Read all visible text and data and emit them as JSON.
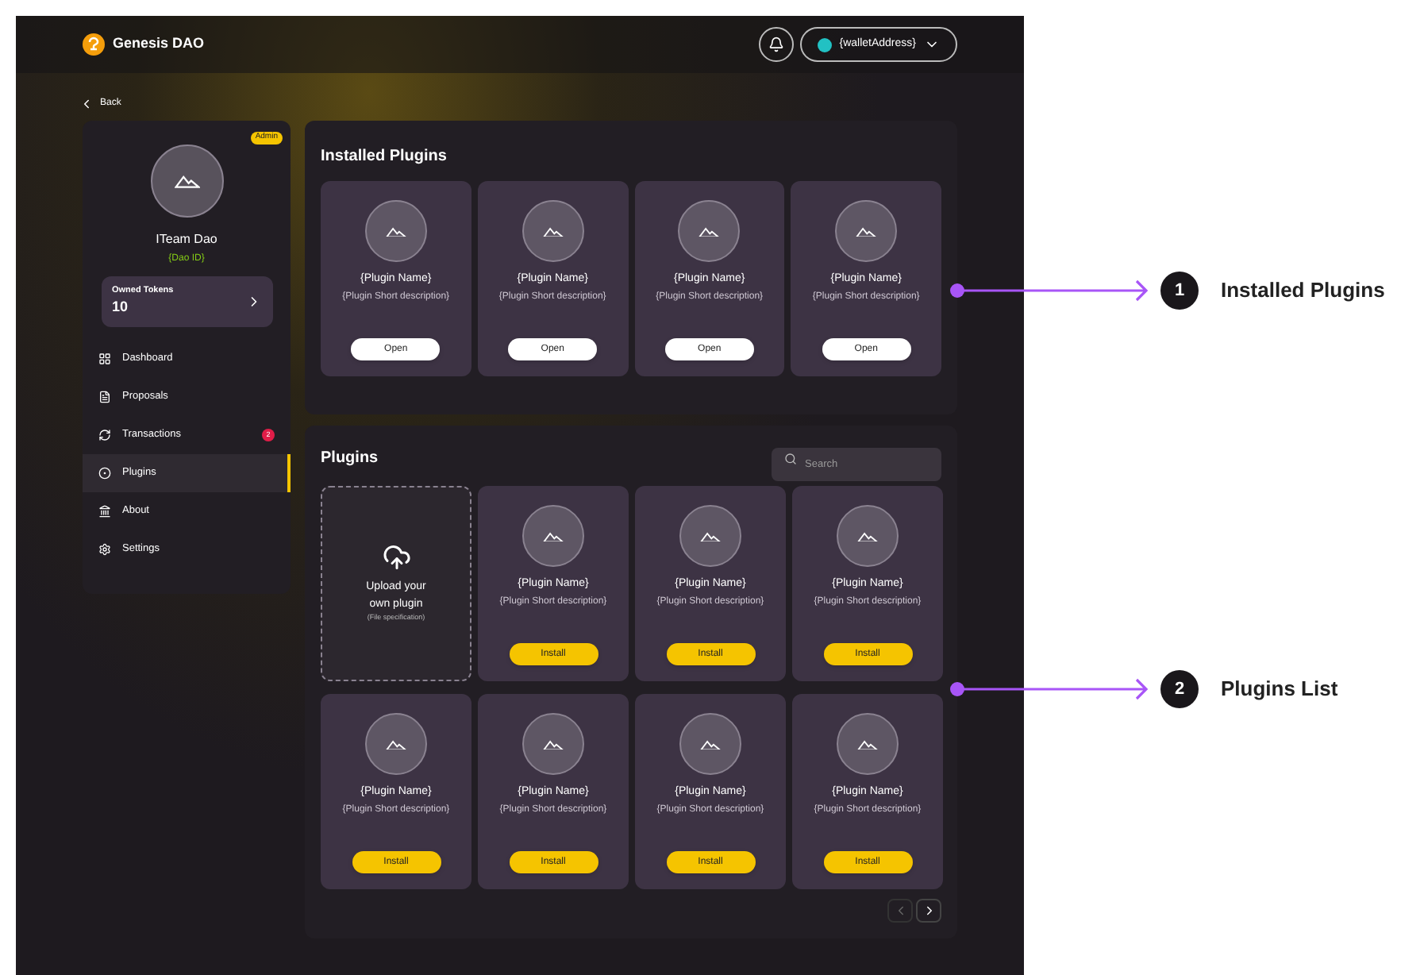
{
  "header": {
    "logo_text": "Genesis DAO",
    "wallet_address": "{walletAddress}"
  },
  "back": "Back",
  "profile": {
    "badge": "Admin",
    "name": "ITeam Dao",
    "dao_id": "{Dao ID}",
    "tokens_label": "Owned Tokens",
    "tokens_value": "10"
  },
  "nav": [
    {
      "kind": "dashboard",
      "label": "Dashboard",
      "selected": false
    },
    {
      "kind": "proposals",
      "label": "Proposals",
      "selected": false
    },
    {
      "kind": "transactions",
      "label": "Transactions",
      "selected": false,
      "badge": "2"
    },
    {
      "kind": "plugins",
      "label": "Plugins",
      "selected": true
    },
    {
      "kind": "about",
      "label": "About",
      "selected": false
    },
    {
      "kind": "settings",
      "label": "Settings",
      "selected": false
    }
  ],
  "installed": {
    "title": "Installed Plugins",
    "plugins": [
      {
        "name": "{Plugin Name}",
        "description": "{Plugin Short description}",
        "button": "Open"
      },
      {
        "name": "{Plugin Name}",
        "description": "{Plugin Short description}",
        "button": "Open"
      },
      {
        "name": "{Plugin Name}",
        "description": "{Plugin Short description}",
        "button": "Open"
      },
      {
        "name": "{Plugin Name}",
        "description": "{Plugin Short description}",
        "button": "Open"
      }
    ]
  },
  "plugins": {
    "title": "Plugins",
    "search": {
      "placeholder": "Search"
    },
    "upload": {
      "title": "Upload your own plugin",
      "subtitle": "(File specification)"
    },
    "items": [
      {
        "name": "{Plugin Name}",
        "description": "{Plugin Short description}",
        "button": "Install"
      },
      {
        "name": "{Plugin Name}",
        "description": "{Plugin Short description}",
        "button": "Install"
      },
      {
        "name": "{Plugin Name}",
        "description": "{Plugin Short description}",
        "button": "Install"
      },
      {
        "name": "{Plugin Name}",
        "description": "{Plugin Short description}",
        "button": "Install"
      },
      {
        "name": "{Plugin Name}",
        "description": "{Plugin Short description}",
        "button": "Install"
      },
      {
        "name": "{Plugin Name}",
        "description": "{Plugin Short description}",
        "button": "Install"
      },
      {
        "name": "{Plugin Name}",
        "description": "{Plugin Short description}",
        "button": "Install"
      }
    ],
    "pagination": {
      "prev_disabled": true,
      "next_disabled": false
    }
  },
  "annotations": [
    {
      "number": "1",
      "label": "Installed Plugins"
    },
    {
      "number": "2",
      "label": "Plugins List"
    }
  ]
}
